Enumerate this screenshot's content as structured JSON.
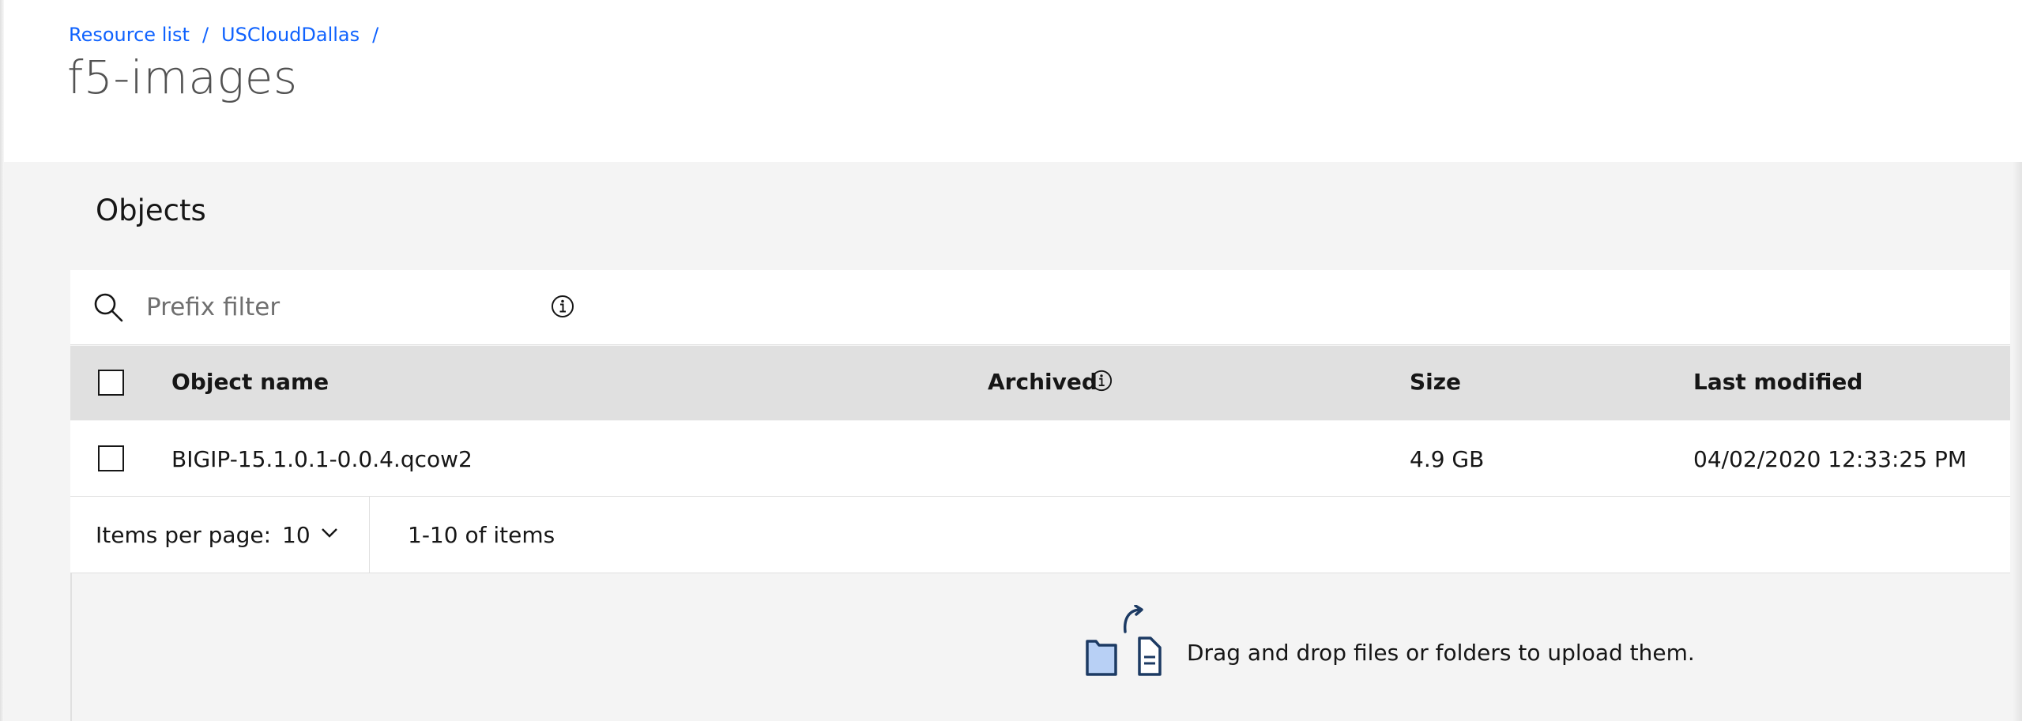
{
  "breadcrumb": {
    "items": [
      "Resource list",
      "USCloudDallas"
    ],
    "separator": "/"
  },
  "page_title": "f5-images",
  "objects": {
    "section_title": "Objects",
    "search": {
      "placeholder": "Prefix filter",
      "value": ""
    },
    "table": {
      "columns": [
        "Object name",
        "Archived",
        "Size",
        "Last modified"
      ],
      "rows": [
        {
          "name": "BIGIP-15.1.0.1-0.0.4.qcow2",
          "archived": "",
          "size": "4.9 GB",
          "last_modified": "04/02/2020 12:33:25 PM"
        }
      ]
    },
    "pagination": {
      "items_per_page_label": "Items per page:",
      "items_per_page_value": "10",
      "range_text": "1-10 of items"
    },
    "dropzone": {
      "text": "Drag and drop files or folders to upload them."
    }
  },
  "colors": {
    "link": "#0f62fe",
    "header_bg": "#e0e0e0",
    "content_bg": "#f4f4f4",
    "upload_icon": "#1c3a63",
    "upload_folder_fill": "#b8d0f5"
  },
  "icons": [
    "search-icon",
    "info-icon",
    "checkbox-icon",
    "chevron-down-icon",
    "upload-icon"
  ]
}
